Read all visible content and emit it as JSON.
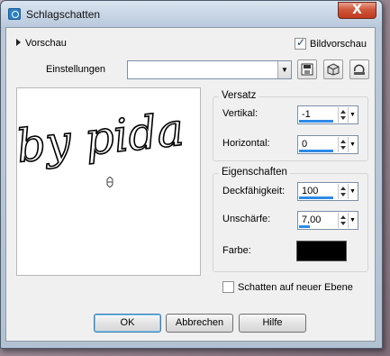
{
  "window": {
    "title": "Schlagschatten",
    "close_label": "X"
  },
  "header": {
    "preview_label": "Vorschau",
    "image_preview_label": "Bildvorschau",
    "image_preview_checked": true,
    "settings_label": "Einstellungen",
    "settings_value": ""
  },
  "preview": {
    "watermark_text": "by pida"
  },
  "offset": {
    "title": "Versatz",
    "vertical_label": "Vertikal:",
    "vertical_value": "-1",
    "horizontal_label": "Horizontal:",
    "horizontal_value": "0"
  },
  "properties": {
    "title": "Eigenschaften",
    "opacity_label": "Deckfähigkeit:",
    "opacity_value": "100",
    "blur_label": "Unschärfe:",
    "blur_value": "7,00",
    "color_label": "Farbe:",
    "color_value": "#000000"
  },
  "shadow_on_new_layer_label": "Schatten auf neuer Ebene",
  "shadow_on_new_layer_checked": false,
  "buttons": {
    "ok": "OK",
    "cancel": "Abbrechen",
    "help": "Hilfe"
  },
  "icons": [
    "camera-icon",
    "save-preset-icon",
    "cube-icon",
    "reset-icon",
    "move-icon"
  ]
}
